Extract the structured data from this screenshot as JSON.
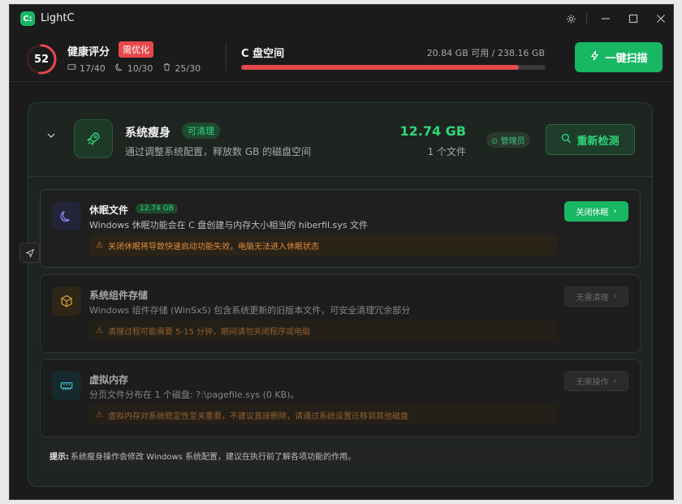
{
  "app": {
    "title": "LightC",
    "logo": "C:"
  },
  "titlebar": {
    "settings_icon": "gear-icon",
    "min_icon": "minimize-icon",
    "max_icon": "maximize-icon",
    "close_icon": "close-icon"
  },
  "health": {
    "score": "52",
    "score_fraction": 0.52,
    "label": "健康评分",
    "badge": "需优化",
    "stats": [
      {
        "icon": "disk-icon",
        "value": "17/40"
      },
      {
        "icon": "moon-icon",
        "value": "10/30"
      },
      {
        "icon": "trash-icon",
        "value": "25/30"
      }
    ]
  },
  "disk": {
    "label": "C 盘空间",
    "info": "20.84 GB 可用 / 238.16 GB",
    "used_fraction": 0.9125
  },
  "scan_button": {
    "label": "一键扫描",
    "icon": "lightning-icon"
  },
  "section": {
    "title": "系统瘦身",
    "tag": "可清理",
    "desc": "通过调整系统配置，释放数 GB 的磁盘空间",
    "size": "12.74 GB",
    "count": "1 个文件",
    "admin": "管理员",
    "recheck": "重新检测",
    "items": [
      {
        "title": "休眠文件",
        "badge": "12.74 GB",
        "desc": "Windows 休眠功能会在 C 盘创建与内存大小相当的 hiberfil.sys 文件",
        "warn": "关闭休眠将导致快速启动功能失效，电脑无法进入休眠状态",
        "button": "关闭休眠",
        "icon": "moon-icon"
      },
      {
        "title": "系统组件存储",
        "desc": "Windows 组件存储 (WinSxS) 包含系统更新的旧版本文件，可安全清理冗余部分",
        "warn": "清理过程可能需要 5-15 分钟，期间请勿关闭程序或电脑",
        "button": "无需清理",
        "icon": "package-icon"
      },
      {
        "title": "虚拟内存",
        "desc": "分页文件分布在 1 个磁盘: ?:\\pagefile.sys (0 KB)。",
        "warn": "虚拟内存对系统稳定性至关重要，不建议直接删除，请通过系统设置迁移到其他磁盘",
        "button": "无需操作",
        "icon": "memory-icon"
      }
    ],
    "tip_label": "提示:",
    "tip_text": "系统瘦身操作会修改 Windows 系统配置，建议在执行前了解各项功能的作用。"
  },
  "colors": {
    "accent": "#18b763",
    "danger": "#e6484d",
    "warn": "#e08a3a"
  }
}
